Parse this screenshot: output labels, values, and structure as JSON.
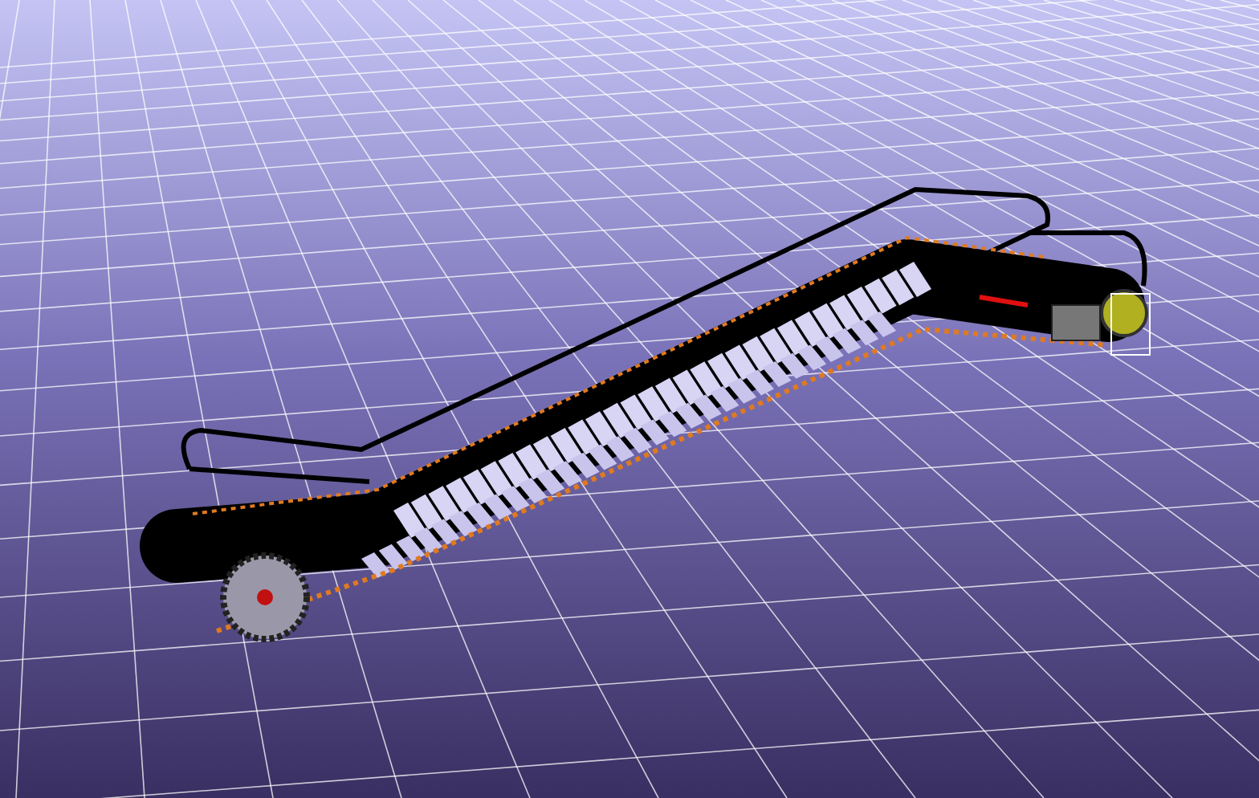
{
  "viewport": {
    "kind": "escalator-model"
  }
}
